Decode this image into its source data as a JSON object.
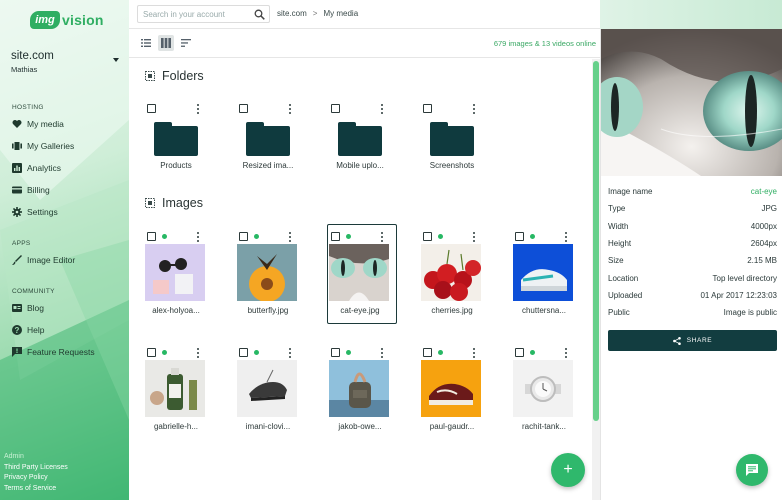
{
  "brand": {
    "img": "img",
    "vision": "vision"
  },
  "account": {
    "site": "site.com",
    "user": "Mathias"
  },
  "nav": {
    "hosting_label": "HOSTING",
    "hosting": [
      {
        "label": "My media",
        "icon": "heart-icon"
      },
      {
        "label": "My Galleries",
        "icon": "gallery-icon"
      },
      {
        "label": "Analytics",
        "icon": "analytics-icon"
      },
      {
        "label": "Billing",
        "icon": "billing-icon"
      },
      {
        "label": "Settings",
        "icon": "gear-icon"
      }
    ],
    "apps_label": "APPS",
    "apps": [
      {
        "label": "Image Editor",
        "icon": "brush-icon"
      }
    ],
    "community_label": "COMMUNITY",
    "community": [
      {
        "label": "Blog",
        "icon": "blog-icon"
      },
      {
        "label": "Help",
        "icon": "help-icon"
      },
      {
        "label": "Feature Requests",
        "icon": "feedback-icon"
      }
    ]
  },
  "footer": {
    "admin": "Admin",
    "links": [
      "Third Party Licenses",
      "Privacy Policy",
      "Terms of Service"
    ]
  },
  "search": {
    "placeholder": "Search in your account"
  },
  "breadcrumb": {
    "root": "site.com",
    "separator": ">",
    "current": "My media"
  },
  "toolbar": {
    "count_text": "679 images & 13 videos online"
  },
  "sections": {
    "folders": "Folders",
    "images": "Images"
  },
  "folders": [
    "Products",
    "Resized ima...",
    "Mobile uplo...",
    "Screenshots"
  ],
  "images": [
    {
      "name": "alex-holyoa...",
      "thumb": "sunglasses"
    },
    {
      "name": "butterfly.jpg",
      "thumb": "butterfly"
    },
    {
      "name": "cat-eye.jpg",
      "thumb": "cat",
      "selected": true
    },
    {
      "name": "cherries.jpg",
      "thumb": "cherries"
    },
    {
      "name": "chuttersna...",
      "thumb": "sneaker"
    },
    {
      "name": "gabrielle-h...",
      "thumb": "bottle"
    },
    {
      "name": "imani-clovi...",
      "thumb": "shoe"
    },
    {
      "name": "jakob-owe...",
      "thumb": "backpack"
    },
    {
      "name": "paul-gaudr...",
      "thumb": "vans"
    },
    {
      "name": "rachit-tank...",
      "thumb": "watch"
    }
  ],
  "details": [
    {
      "label": "Image name",
      "value": "cat-eye",
      "accent": true
    },
    {
      "label": "Type",
      "value": "JPG"
    },
    {
      "label": "Width",
      "value": "4000px"
    },
    {
      "label": "Height",
      "value": "2604px"
    },
    {
      "label": "Size",
      "value": "2.15 MB"
    },
    {
      "label": "Location",
      "value": "Top level directory"
    },
    {
      "label": "Uploaded",
      "value": "01 Apr 2017 12:23:03"
    },
    {
      "label": "Public",
      "value": "Image is public"
    }
  ],
  "share": {
    "label": "SHARE"
  },
  "fab": {
    "add_label": "+"
  },
  "colors": {
    "accent": "#2fae62",
    "dark": "#123d40",
    "folder": "#0f3a3e"
  }
}
